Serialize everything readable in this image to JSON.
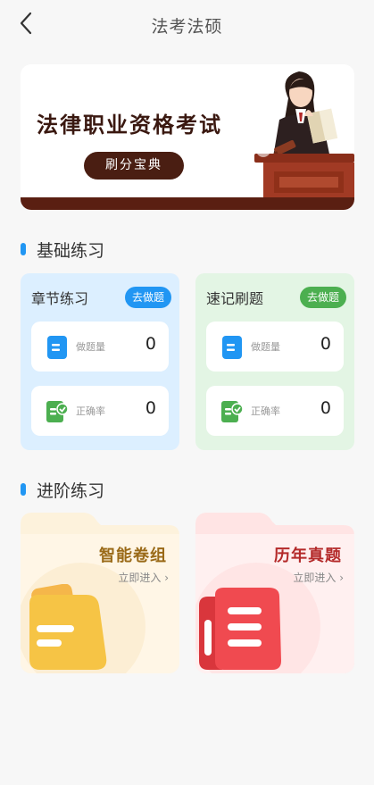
{
  "header": {
    "title": "法考法硕",
    "back_icon": "chevron-left-icon"
  },
  "banner": {
    "title": "法律职业资格考试",
    "button_label": "刷分宝典"
  },
  "basic_section": {
    "title": "基础练习"
  },
  "cards": [
    {
      "name": "章节练习",
      "action": "去做题",
      "accent": "#2196f3",
      "stats": [
        {
          "label": "做题量",
          "value": "0",
          "icon": "document-icon"
        },
        {
          "label": "正确率",
          "value": "0",
          "icon": "checklist-icon"
        }
      ]
    },
    {
      "name": "速记刷题",
      "action": "去做题",
      "accent": "#4caf50",
      "stats": [
        {
          "label": "做题量",
          "value": "0",
          "icon": "document-icon"
        },
        {
          "label": "正确率",
          "value": "0",
          "icon": "checklist-icon"
        }
      ]
    }
  ],
  "advanced_section": {
    "title": "进阶练习"
  },
  "advanced": [
    {
      "title": "智能卷组",
      "enter": "立即进入",
      "icon": "folder-icon"
    },
    {
      "title": "历年真题",
      "enter": "立即进入",
      "icon": "folder-icon"
    }
  ]
}
